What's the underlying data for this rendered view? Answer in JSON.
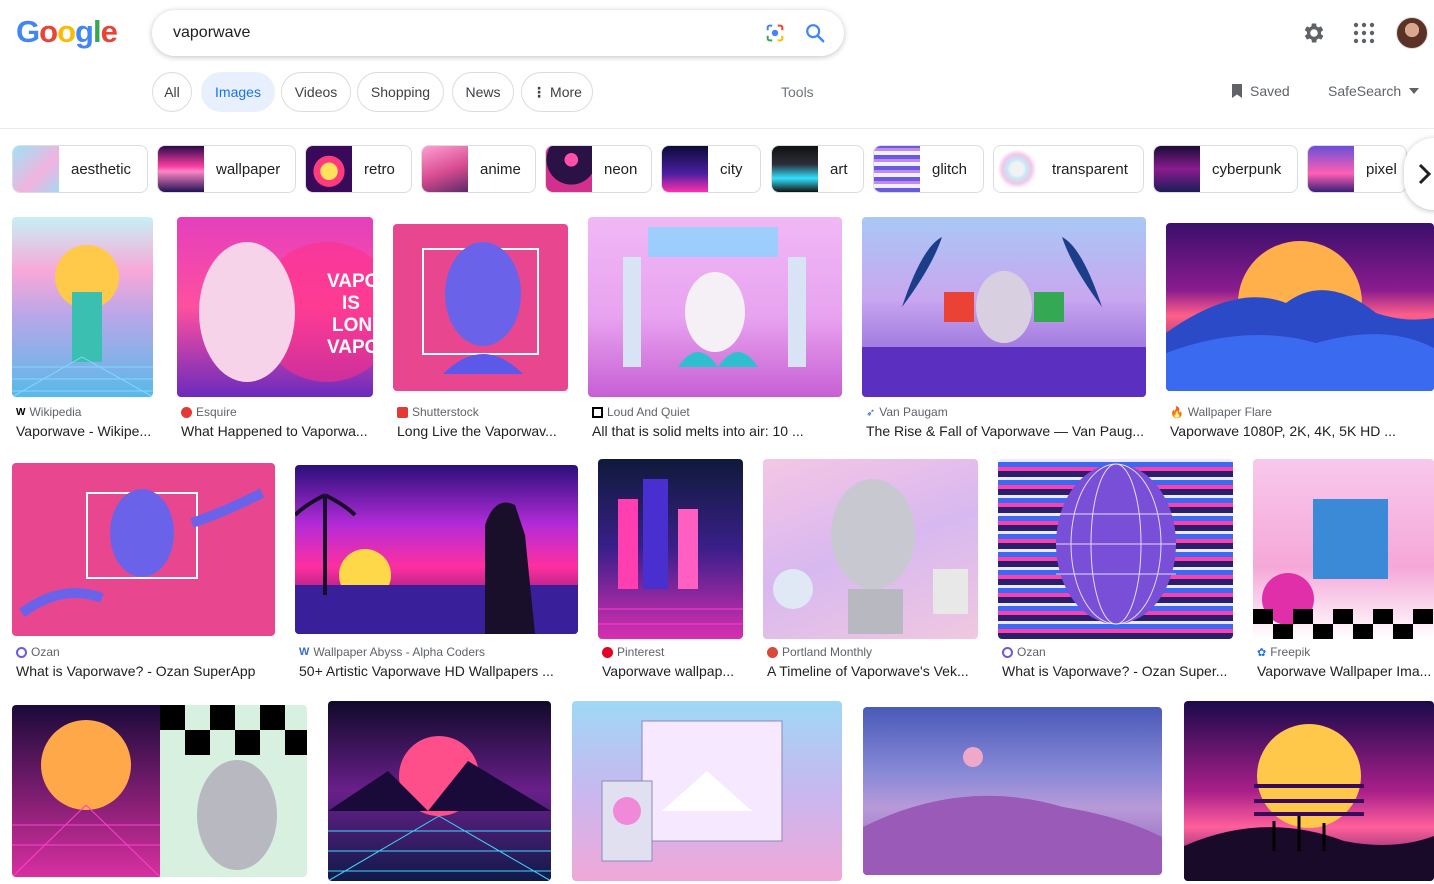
{
  "search": {
    "query": "vaporwave"
  },
  "nav": {
    "tabs": [
      {
        "label": "All"
      },
      {
        "label": "Images",
        "active": true
      },
      {
        "label": "Videos"
      },
      {
        "label": "Shopping"
      },
      {
        "label": "News"
      },
      {
        "label": "More"
      }
    ],
    "tools": "Tools",
    "saved": "Saved",
    "safesearch": "SafeSearch"
  },
  "related": [
    {
      "label": "aesthetic"
    },
    {
      "label": "wallpaper"
    },
    {
      "label": "retro"
    },
    {
      "label": "anime"
    },
    {
      "label": "neon"
    },
    {
      "label": "city"
    },
    {
      "label": "art"
    },
    {
      "label": "glitch"
    },
    {
      "label": "transparent"
    },
    {
      "label": "cyberpunk"
    },
    {
      "label": "pixel"
    }
  ],
  "results": [
    {
      "source": "Wikipedia",
      "title": "Vaporwave - Wikipe..."
    },
    {
      "source": "Esquire",
      "title": "What Happened to Vaporwa..."
    },
    {
      "source": "Shutterstock",
      "title": "Long Live the Vaporwav..."
    },
    {
      "source": "Loud And Quiet",
      "title": "All that is solid melts into air: 10 ..."
    },
    {
      "source": "Van Paugam",
      "title": "The Rise & Fall of Vaporwave — Van Paug..."
    },
    {
      "source": "Wallpaper Flare",
      "title": "Vaporwave 1080P, 2K, 4K, 5K HD ..."
    },
    {
      "source": "Ozan",
      "title": "What is Vaporwave? - Ozan SuperApp"
    },
    {
      "source": "Wallpaper Abyss - Alpha Coders",
      "title": "50+ Artistic Vaporwave HD Wallpapers ..."
    },
    {
      "source": "Pinterest",
      "title": "Vaporwave wallpap..."
    },
    {
      "source": "Portland Monthly",
      "title": "A Timeline of Vaporwave's Vek..."
    },
    {
      "source": "Ozan",
      "title": "What is Vaporwave? - Ozan Super..."
    },
    {
      "source": "Freepik",
      "title": "Vaporwave Wallpaper Ima..."
    }
  ],
  "colors": {
    "accent": "#1a73e8",
    "chip_active_bg": "#e8f0fe"
  }
}
